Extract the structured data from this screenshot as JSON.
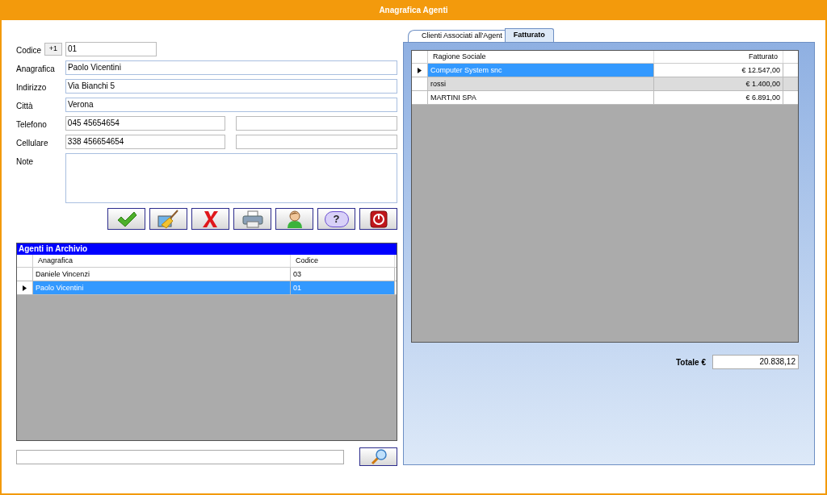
{
  "window": {
    "title": "Anagrafica Agenti"
  },
  "form": {
    "fields": [
      {
        "kind": "code",
        "label": "Codice",
        "button": "+1",
        "value": "01"
      },
      {
        "kind": "wide",
        "label": "Anagrafica",
        "value": "Paolo Vicentini"
      },
      {
        "kind": "wide",
        "label": "Indirizzo",
        "value": "Via Bianchi 5"
      },
      {
        "kind": "wide",
        "label": "Città",
        "value": "Verona"
      },
      {
        "kind": "pair",
        "label": "Telefono",
        "value": "045 45654654"
      },
      {
        "kind": "pair",
        "label": "Cellulare",
        "value": "338 456654654"
      },
      {
        "kind": "multiline",
        "label": "Note"
      }
    ]
  },
  "toolbar": [
    {
      "kind": "save"
    },
    {
      "kind": "clean"
    },
    {
      "kind": "delete"
    },
    {
      "kind": "print"
    },
    {
      "kind": "user"
    },
    {
      "kind": "help",
      "label": "?"
    },
    {
      "kind": "exit"
    }
  ],
  "agents_grid": {
    "title": "Agenti in Archivio",
    "columns": [
      "Anagrafica",
      "Codice"
    ],
    "rows": [
      {
        "cells": [
          "Daniele Vincenzi",
          "03"
        ],
        "selected": false
      },
      {
        "cells": [
          "Paolo Vicentini",
          "01"
        ],
        "selected": true
      }
    ]
  },
  "search": {
    "kind": "search"
  },
  "tabs": [
    {
      "label": "Clienti Associati all'Agent",
      "selected": false
    },
    {
      "label": "Fatturato",
      "selected": true
    }
  ],
  "clients_grid": {
    "columns": [
      "Ragione Sociale",
      "Fatturato"
    ],
    "rows": [
      {
        "cells": [
          "Computer System snc",
          "€ 12.547,00"
        ],
        "selected": true
      },
      {
        "cells": [
          "rossi",
          "€ 1.400,00"
        ],
        "selected": false
      },
      {
        "cells": [
          "MARTINI SPA",
          "€ 6.891,00"
        ],
        "selected": false
      }
    ]
  },
  "total": {
    "label": "Totale €",
    "value": "20.838,12"
  }
}
